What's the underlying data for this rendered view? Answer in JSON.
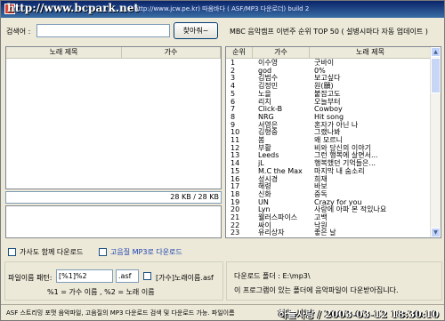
{
  "window": {
    "watermark": "http://www.bcpark.net",
    "title": "http://www.jcw.pe.kr) 따옴바다 ( ASF/MP3 다운로더) build 2"
  },
  "search": {
    "label": "검색어 :",
    "value": "",
    "button_label": "찾아줘~"
  },
  "result_list": {
    "col_title": "노래 제목",
    "col_artist": "가수"
  },
  "download_progress": "28 KB / 28 KB",
  "chart": {
    "heading": "MBC 음악캠프 이번주 순위 TOP 50 ( 설병시마다 자동 업데이트 )",
    "col_rank": "순위",
    "col_artist": "가수",
    "col_title": "노래 제목",
    "rows": [
      {
        "rank": "1",
        "artist": "이수영",
        "title": "굿바이"
      },
      {
        "rank": "2",
        "artist": "god",
        "title": "0%"
      },
      {
        "rank": "3",
        "artist": "김범수",
        "title": "보고싶다"
      },
      {
        "rank": "4",
        "artist": "김정민",
        "title": "원(願)"
      },
      {
        "rank": "5",
        "artist": "노을",
        "title": "붙잡고도"
      },
      {
        "rank": "6",
        "artist": "리치",
        "title": "오늘부터"
      },
      {
        "rank": "7",
        "artist": "Click-B",
        "title": "Cowboy"
      },
      {
        "rank": "8",
        "artist": "NRG",
        "title": "Hit song"
      },
      {
        "rank": "9",
        "artist": "서영은",
        "title": "혼자가 아닌 나"
      },
      {
        "rank": "10",
        "artist": "김형중",
        "title": "그랬나봐"
      },
      {
        "rank": "11",
        "artist": "봄",
        "title": "왜 모르니"
      },
      {
        "rank": "12",
        "artist": "부활",
        "title": "비와 당신의 이야기"
      },
      {
        "rank": "13",
        "artist": "Leeds",
        "title": "그런 행복에 살면서..."
      },
      {
        "rank": "14",
        "artist": "jL",
        "title": "행복했던 기억들은..."
      },
      {
        "rank": "15",
        "artist": "M.C the Max",
        "title": "마지막 내 숨소리"
      },
      {
        "rank": "16",
        "artist": "성시경",
        "title": "희재"
      },
      {
        "rank": "17",
        "artist": "해령",
        "title": "바보"
      },
      {
        "rank": "18",
        "artist": "신화",
        "title": "중독"
      },
      {
        "rank": "19",
        "artist": "UN",
        "title": "Crazy for you"
      },
      {
        "rank": "20",
        "artist": "Lyn",
        "title": "사랑에 아파 본 적있나요"
      },
      {
        "rank": "21",
        "artist": "웰러스파이스",
        "title": "고백"
      },
      {
        "rank": "22",
        "artist": "싸이",
        "title": "낙원"
      },
      {
        "rank": "23",
        "artist": "유리상자",
        "title": "좋은 날"
      }
    ]
  },
  "options": {
    "with_artist_label": "가사도 함께 다운로드",
    "with_artist_checked": false,
    "hq_mp3_label": "고음질 MP3로 다운로드",
    "hq_mp3_checked": false
  },
  "filename": {
    "label": "파일이름 패턴:",
    "pattern_value": "[%1]%2",
    "ext_value": ".asf",
    "example": "[가수]노래이름.asf",
    "hint": "%1 = 가수 이름 , %2 = 노래 이름"
  },
  "download_folder": {
    "label": "다운로드 폴더 : E:\\mp3\\",
    "note": "이 프로그램이 있는 폴더에 음악파일이 다운받아집니다."
  },
  "status_bar": {
    "text": "ASF 스트리밍 포맷 음악파일, 고음질의 MP3 다운로드 검색 및 다운로드 가능. 파일이름",
    "stamp": "하늘사랑 / 2003-03-12 18:30:10"
  },
  "colors": {
    "title_bar_start": "#0a246a",
    "title_bar_end": "#3a6ea5",
    "hq_label": "#1a3fb0"
  }
}
